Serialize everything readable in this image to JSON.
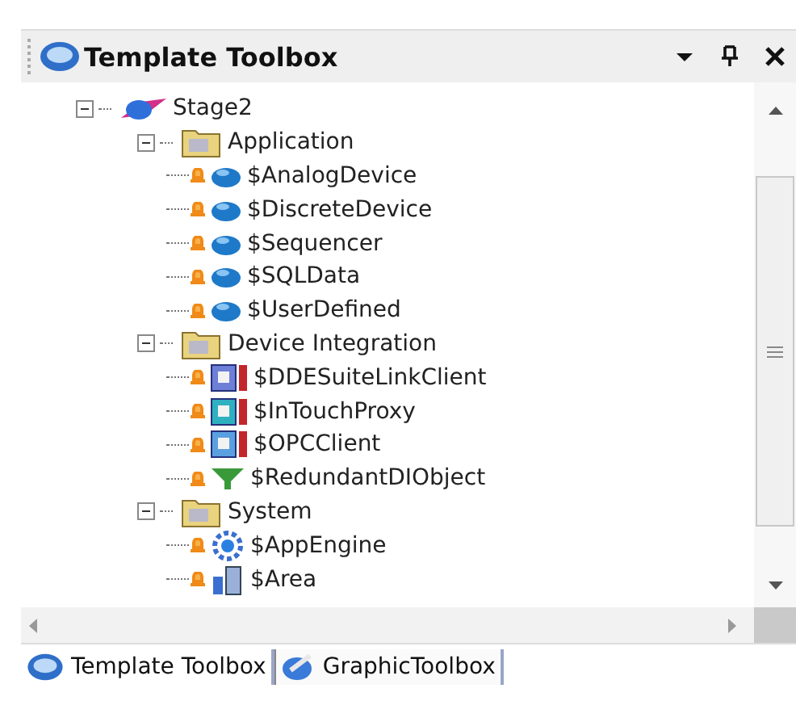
{
  "panel": {
    "title": "Template Toolbox"
  },
  "tree": [
    {
      "label": "Stage2",
      "kind": "galaxy",
      "expanded": true,
      "children": [
        {
          "label": "Application",
          "kind": "folder",
          "expanded": true,
          "children": [
            {
              "label": "$AnalogDevice",
              "kind": "sphere"
            },
            {
              "label": "$DiscreteDevice",
              "kind": "sphere"
            },
            {
              "label": "$Sequencer",
              "kind": "sphere"
            },
            {
              "label": "$SQLData",
              "kind": "sphere"
            },
            {
              "label": "$UserDefined",
              "kind": "sphere"
            }
          ]
        },
        {
          "label": "Device Integration",
          "kind": "folder",
          "expanded": true,
          "children": [
            {
              "label": "$DDESuiteLinkClient",
              "kind": "dde"
            },
            {
              "label": "$InTouchProxy",
              "kind": "proxy"
            },
            {
              "label": "$OPCClient",
              "kind": "opc"
            },
            {
              "label": "$RedundantDIObject",
              "kind": "redundant"
            }
          ]
        },
        {
          "label": "System",
          "kind": "folder",
          "expanded": true,
          "children": [
            {
              "label": "$AppEngine",
              "kind": "engine"
            },
            {
              "label": "$Area",
              "kind": "area"
            }
          ]
        }
      ]
    }
  ],
  "tabs": [
    {
      "label": "Template Toolbox",
      "kind": "template",
      "selected": true
    },
    {
      "label": "GraphicToolbox",
      "kind": "graphic",
      "selected": false
    }
  ]
}
